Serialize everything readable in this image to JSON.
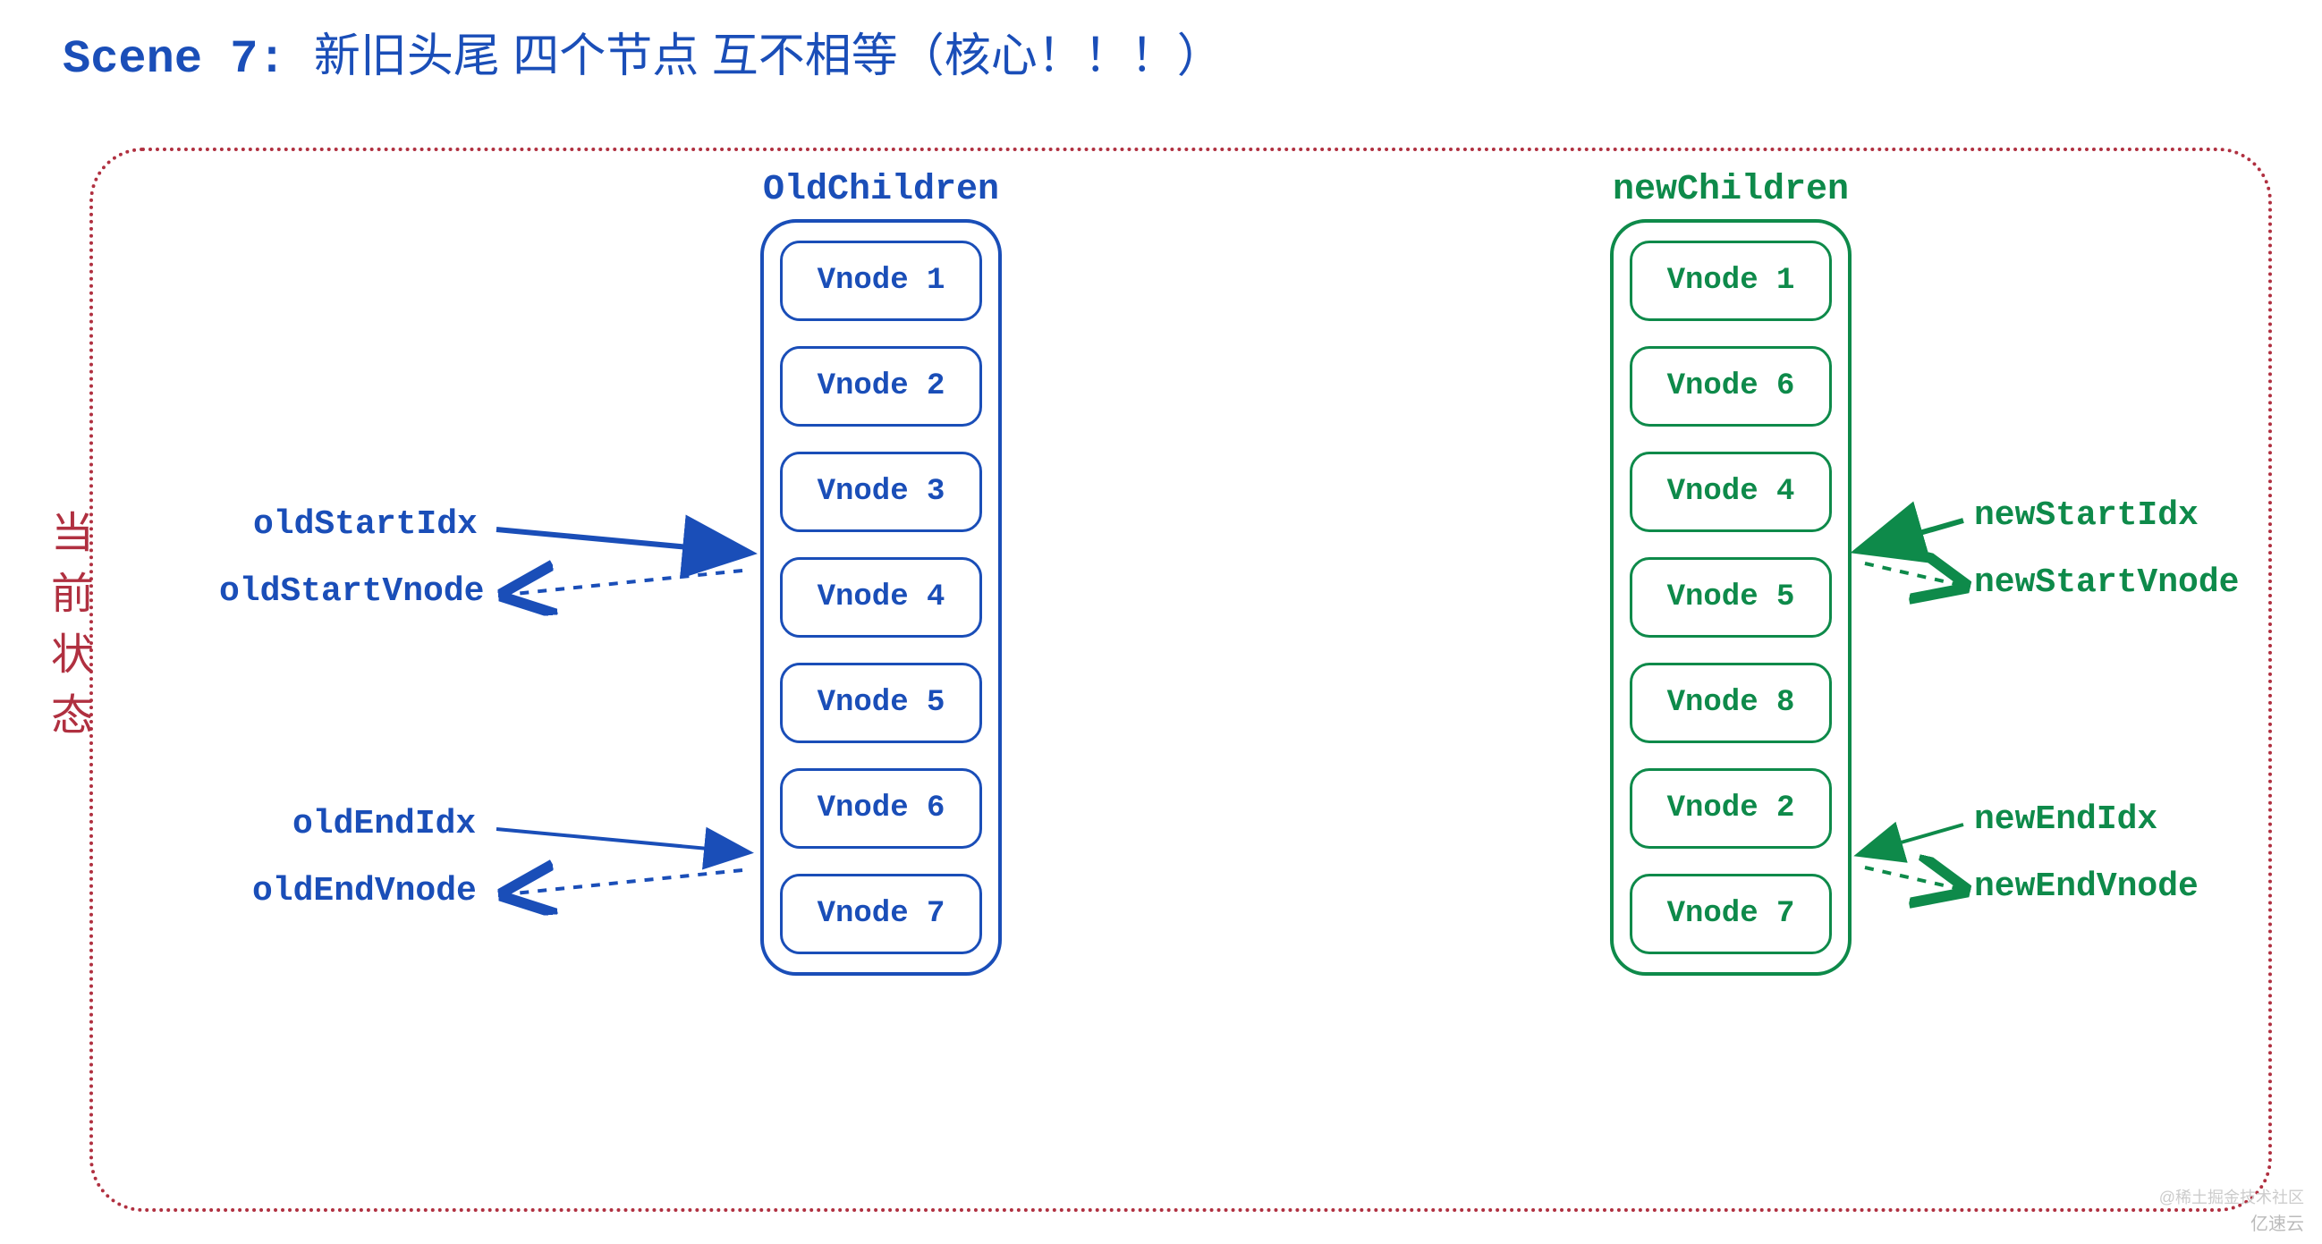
{
  "title_scene": "Scene 7:",
  "title_cn": "新旧头尾  四个节点  互不相等（核心！！！）",
  "state_label": "当前状态",
  "old": {
    "title": "OldChildren",
    "nodes": [
      "Vnode 1",
      "Vnode 2",
      "Vnode 3",
      "Vnode 4",
      "Vnode 5",
      "Vnode 6",
      "Vnode 7"
    ]
  },
  "new": {
    "title": "newChildren",
    "nodes": [
      "Vnode 1",
      "Vnode 6",
      "Vnode 4",
      "Vnode 5",
      "Vnode 8",
      "Vnode 2",
      "Vnode 7"
    ]
  },
  "pointers": {
    "oldStartIdx": "oldStartIdx",
    "oldStartVnode": "oldStartVnode",
    "oldEndIdx": "oldEndIdx",
    "oldEndVnode": "oldEndVnode",
    "newStartIdx": "newStartIdx",
    "newStartVnode": "newStartVnode",
    "newEndIdx": "newEndIdx",
    "newEndVnode": "newEndVnode"
  },
  "colors": {
    "blue": "#1a4eb8",
    "green": "#0e8a4a",
    "red": "#b03040"
  },
  "watermark_top": "@稀土掘金技术社区",
  "watermark_bottom": "亿速云"
}
